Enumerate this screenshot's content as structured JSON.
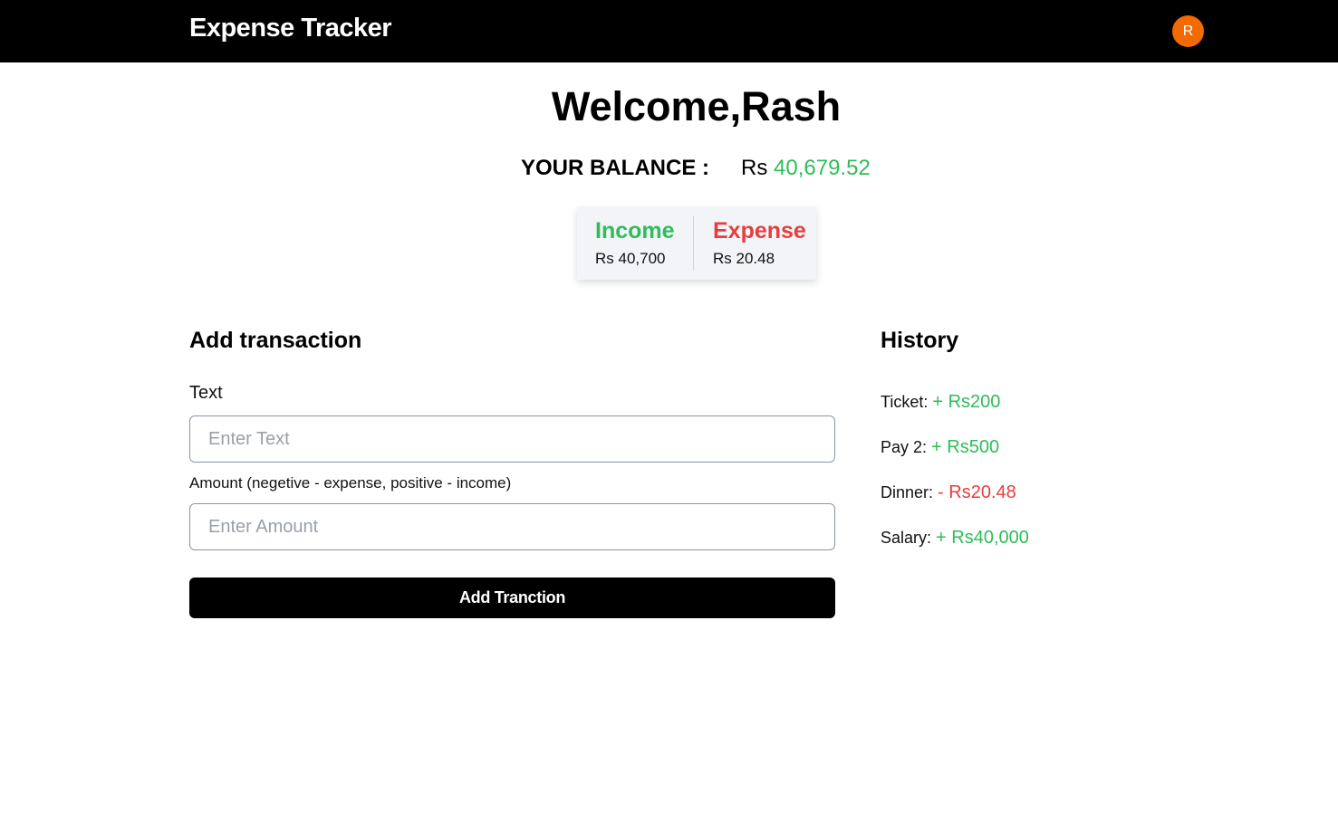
{
  "header": {
    "brand": "Expense Tracker",
    "avatar_initial": "R"
  },
  "welcome": "Welcome,Rash",
  "balance": {
    "label": "YOUR BALANCE :",
    "currency": "Rs",
    "amount": "40,679.52"
  },
  "summary": {
    "income_label": "Income",
    "income_amount": "Rs 40,700",
    "expense_label": "Expense",
    "expense_amount": "Rs 20.48"
  },
  "add_transaction": {
    "title": "Add transaction",
    "text_label": "Text",
    "text_placeholder": "Enter Text",
    "text_value": "",
    "amount_label": "Amount (negetive - expense, positive - income)",
    "amount_placeholder": "Enter Amount",
    "amount_value": "",
    "button_label": "Add Tranction"
  },
  "history": {
    "title": "History",
    "items": [
      {
        "name": "Ticket:",
        "amount": "+ Rs200",
        "type": "income"
      },
      {
        "name": "Pay 2:",
        "amount": "+ Rs500",
        "type": "income"
      },
      {
        "name": "Dinner:",
        "amount": "- Rs20.48",
        "type": "expense"
      },
      {
        "name": "Salary:",
        "amount": "+ Rs40,000",
        "type": "income"
      }
    ]
  },
  "colors": {
    "income": "#2ebd59",
    "expense": "#e53e3e",
    "avatar": "#f26a00",
    "navbar": "#000000"
  }
}
